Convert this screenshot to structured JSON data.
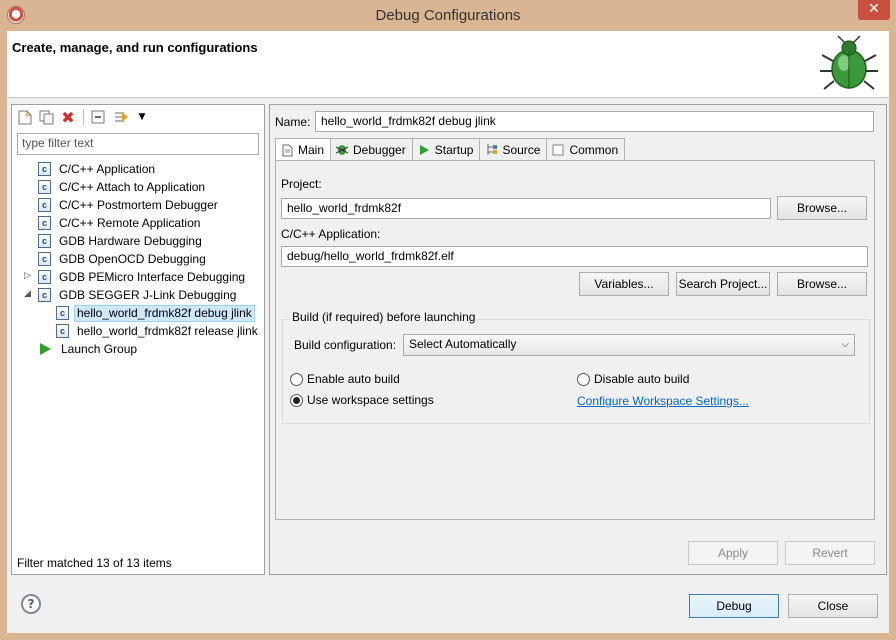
{
  "window": {
    "title": "Debug Configurations",
    "close_glyph": "✕"
  },
  "header": {
    "title": "Create, manage, and run configurations"
  },
  "toolbar": {
    "icons": [
      "new-config-icon",
      "duplicate-icon",
      "delete-icon",
      "collapse-all-icon",
      "filter-icon"
    ]
  },
  "filter": {
    "placeholder": "type filter text",
    "status": "Filter matched 13 of 13 items"
  },
  "tree": {
    "items": [
      {
        "label": "C/C++ Application",
        "icon": "c-config-icon"
      },
      {
        "label": "C/C++ Attach to Application",
        "icon": "c-config-icon"
      },
      {
        "label": "C/C++ Postmortem Debugger",
        "icon": "c-config-icon"
      },
      {
        "label": "C/C++ Remote Application",
        "icon": "c-config-icon"
      },
      {
        "label": "GDB Hardware Debugging",
        "icon": "c-config-icon"
      },
      {
        "label": "GDB OpenOCD Debugging",
        "icon": "c-config-icon"
      },
      {
        "label": "GDB PEMicro Interface Debugging",
        "icon": "c-config-icon",
        "expander": "collapsed"
      },
      {
        "label": "GDB SEGGER J-Link Debugging",
        "icon": "c-config-icon",
        "expander": "expanded"
      },
      {
        "label": "hello_world_frdmk82f debug jlink",
        "icon": "c-config-icon",
        "selected": true
      },
      {
        "label": "hello_world_frdmk82f release jlink",
        "icon": "c-config-icon"
      },
      {
        "label": "Launch Group",
        "icon": "launch-group-icon"
      }
    ]
  },
  "config": {
    "name_label": "Name:",
    "name_value": "hello_world_frdmk82f debug jlink",
    "tabs": [
      {
        "label": "Main",
        "icon": "main-tab-icon",
        "active": true
      },
      {
        "label": "Debugger",
        "icon": "debugger-tab-icon"
      },
      {
        "label": "Startup",
        "icon": "startup-tab-icon"
      },
      {
        "label": "Source",
        "icon": "source-tab-icon"
      },
      {
        "label": "Common",
        "icon": "common-tab-icon"
      }
    ],
    "project_label": "Project:",
    "project_value": "hello_world_frdmk82f",
    "browse_label": "Browse...",
    "app_label": "C/C++ Application:",
    "app_value": "debug/hello_world_frdmk82f.elf",
    "variables_label": "Variables...",
    "search_project_label": "Search Project...",
    "build_group_title": "Build (if required) before launching",
    "build_config_label": "Build configuration:",
    "build_config_value": "Select Automatically",
    "enable_auto_build": "Enable auto build",
    "disable_auto_build": "Disable auto build",
    "use_workspace_settings": "Use workspace settings",
    "configure_workspace_link": "Configure Workspace Settings...",
    "apply_label": "Apply",
    "revert_label": "Revert"
  },
  "footer": {
    "help_glyph": "?",
    "debug_label": "Debug",
    "close_label": "Close"
  },
  "colors": {
    "window_frame": "#d9b593",
    "close_button": "#c7503f",
    "selection": "#cde8ff",
    "link": "#0066cc"
  }
}
